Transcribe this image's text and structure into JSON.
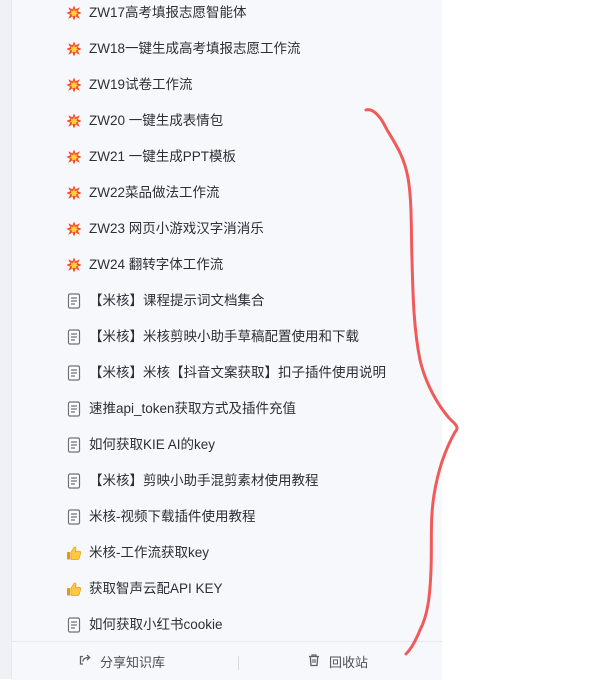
{
  "items": [
    {
      "icon": "explosion-icon",
      "label": "ZW17高考填报志愿智能体"
    },
    {
      "icon": "explosion-icon",
      "label": "ZW18一键生成高考填报志愿工作流"
    },
    {
      "icon": "explosion-icon",
      "label": "ZW19试卷工作流"
    },
    {
      "icon": "explosion-icon",
      "label": "ZW20 一键生成表情包"
    },
    {
      "icon": "explosion-icon",
      "label": "ZW21 一键生成PPT模板"
    },
    {
      "icon": "explosion-icon",
      "label": "ZW22菜品做法工作流"
    },
    {
      "icon": "explosion-icon",
      "label": "ZW23 网页小游戏汉字消消乐"
    },
    {
      "icon": "explosion-icon",
      "label": "ZW24 翻转字体工作流"
    },
    {
      "icon": "document-icon",
      "label": "【米核】课程提示词文档集合"
    },
    {
      "icon": "document-icon",
      "label": "【米核】米核剪映小助手草稿配置使用和下载"
    },
    {
      "icon": "document-icon",
      "label": "【米核】米核【抖音文案获取】扣子插件使用说明"
    },
    {
      "icon": "document-icon",
      "label": "速推api_token获取方式及插件充值"
    },
    {
      "icon": "document-icon",
      "label": "如何获取KIE AI的key"
    },
    {
      "icon": "document-icon",
      "label": "【米核】剪映小助手混剪素材使用教程"
    },
    {
      "icon": "document-icon",
      "label": "米核-视频下载插件使用教程"
    },
    {
      "icon": "thumbs-up-icon",
      "label": "米核-工作流获取key"
    },
    {
      "icon": "thumbs-up-icon",
      "label": "获取智声云配API KEY"
    },
    {
      "icon": "document-icon",
      "label": "如何获取小红书cookie"
    }
  ],
  "footer": {
    "share_label": "分享知识库",
    "recycle_label": "回收站",
    "share_icon": "share-icon",
    "recycle_icon": "trash-icon"
  },
  "colors": {
    "panel_bg": "#f7f8fb",
    "text": "#2b2f36",
    "annotation_stroke": "#f05a5a"
  }
}
